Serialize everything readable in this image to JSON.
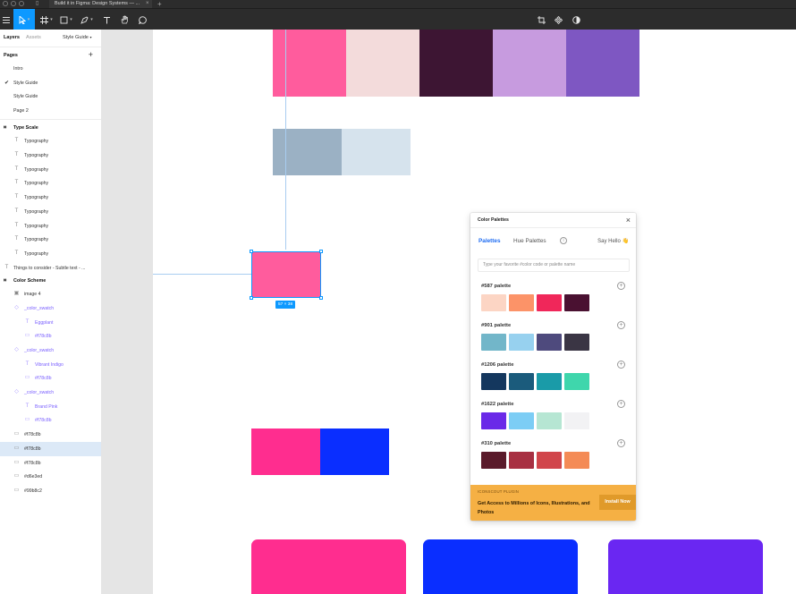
{
  "window": {
    "tab_title": "Build it in Figma: Design Systems — ...",
    "tab_close": "×",
    "tab_add": "+"
  },
  "toolbar": {
    "menu_icon": "hamburger-icon",
    "tools": [
      "move-tool",
      "frame-tool",
      "shape-tool",
      "pen-tool",
      "text-tool",
      "hand-tool",
      "comment-tool"
    ],
    "right_tools": [
      "crop-icon",
      "component-icon",
      "contrast-icon"
    ],
    "active_color": "#0d99ff"
  },
  "left_panel": {
    "tabs": [
      "Layers",
      "Assets"
    ],
    "page_dropdown": "Style Guide",
    "pages_title": "Pages",
    "pages_add": "+",
    "pages": [
      {
        "label": "Intro",
        "checked": false
      },
      {
        "label": "Style Guide",
        "checked": true
      },
      {
        "label": "Style Guide",
        "checked": false
      },
      {
        "label": "Page 2",
        "checked": false
      }
    ],
    "type_scale_title": "Type Scale",
    "type_layers": [
      "Typography",
      "Typography",
      "Typography",
      "Typography",
      "Typography",
      "Typography",
      "Typography",
      "Typography",
      "Typography"
    ],
    "things_layer": "Things to consider - Subtle text - ...",
    "color_scheme_title": "Color Scheme",
    "color_layers": [
      {
        "label": "image 4",
        "icon": "image-icon",
        "style": "normal"
      },
      {
        "label": "_color_swatch",
        "icon": "component-instance-icon",
        "style": "purple"
      },
      {
        "label": "Eggplant",
        "icon": "text-icon",
        "style": "purple"
      },
      {
        "label": "#f78c8b",
        "icon": "rectangle-icon",
        "style": "purple"
      },
      {
        "label": "_color_swatch",
        "icon": "component-instance-icon",
        "style": "purple"
      },
      {
        "label": "Vibrant Indigo",
        "icon": "text-icon",
        "style": "purple"
      },
      {
        "label": "#f78c8b",
        "icon": "rectangle-icon",
        "style": "purple"
      },
      {
        "label": "_color_swatch",
        "icon": "component-instance-icon",
        "style": "purple"
      },
      {
        "label": "Brand Pink",
        "icon": "text-icon",
        "style": "purple"
      },
      {
        "label": "#f78c8b",
        "icon": "rectangle-icon",
        "style": "purple"
      },
      {
        "label": "#f78c8b",
        "icon": "rectangle-icon",
        "style": "normal"
      },
      {
        "label": "#f78c8b",
        "icon": "rectangle-icon",
        "style": "selected"
      },
      {
        "label": "#f78c8b",
        "icon": "rectangle-icon",
        "style": "normal"
      },
      {
        "label": "#d6e3ed",
        "icon": "rectangle-icon",
        "style": "normal"
      },
      {
        "label": "#99b8c2",
        "icon": "rectangle-icon",
        "style": "normal"
      }
    ]
  },
  "canvas": {
    "selection_size": "57 × 38",
    "colors": {
      "pink": "#ff5c9d",
      "blush": "#f3dbdb",
      "eggplant": "#3d1533",
      "lavender": "#c79bdf",
      "purple": "#7e57c2",
      "slate": "#9bb1c4",
      "pale_blue": "#d6e3ed",
      "hot_pink": "#ff2d8f",
      "blue": "#0a2eff",
      "violet": "#6a27f2",
      "selected_pink": "#ff5c9d"
    }
  },
  "plugin": {
    "title": "Color Palettes",
    "close": "×",
    "tab_palettes": "Palettes",
    "tab_hue": "Hue Palettes",
    "info_icon": "i",
    "say_hello": "Say Hello 👋",
    "search_placeholder": "Type your favorite #color code or palette name",
    "palettes": [
      {
        "name": "#587 palette",
        "colors": [
          "#fcd5c4",
          "#fc9368",
          "#f0275a",
          "#4a1131"
        ]
      },
      {
        "name": "#901 palette",
        "colors": [
          "#72b6c9",
          "#97d1ef",
          "#4e4a7d",
          "#3a3544"
        ]
      },
      {
        "name": "#1206 palette",
        "colors": [
          "#14375e",
          "#1b5b7c",
          "#1a9ba8",
          "#3fd6ac"
        ]
      },
      {
        "name": "#1622 palette",
        "colors": [
          "#6a29e8",
          "#7ccdf5",
          "#b6e6d3",
          "#f2f2f4"
        ]
      },
      {
        "name": "#310 palette",
        "colors": [
          "#5a1a2a",
          "#a83042",
          "#d1454b",
          "#f48b56"
        ]
      }
    ],
    "palette_add": "+",
    "footer_small": "ICONSCOUT PLUGIN",
    "footer_text": "Get Access to Millions of Icons, Illustrations, and Photos",
    "footer_button": "Install Now"
  }
}
